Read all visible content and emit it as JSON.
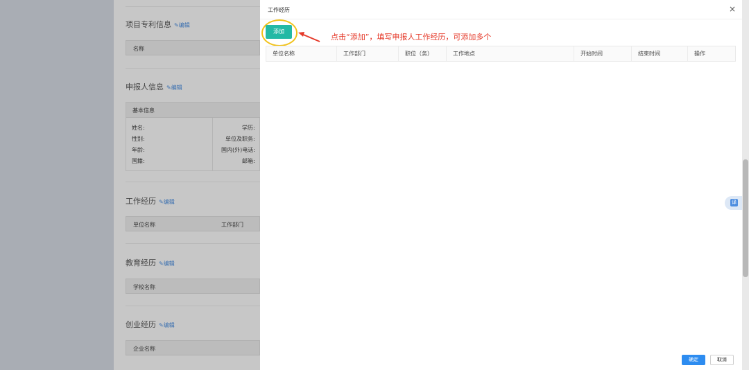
{
  "background_page": {
    "sections": [
      {
        "title": "项目专利信息",
        "edit": "编辑",
        "columns": [
          "名称"
        ]
      },
      {
        "title": "申报人信息",
        "edit": "编辑",
        "sub_header": "基本信息",
        "fields_left": [
          "姓名:",
          "性别:",
          "年龄:",
          "国籍:"
        ],
        "fields_right": [
          "学历:",
          "单位及职务:",
          "国内(外)电话:",
          "邮箱:"
        ]
      },
      {
        "title": "工作经历",
        "edit": "编辑",
        "columns": [
          "单位名称",
          "工作部门"
        ]
      },
      {
        "title": "教育经历",
        "edit": "编辑",
        "columns": [
          "学校名称"
        ]
      },
      {
        "title": "创业经历",
        "edit": "编辑",
        "columns": [
          "企业名称"
        ]
      }
    ]
  },
  "drawer": {
    "title": "工作经历",
    "close": "×",
    "add_button": "添加",
    "annotation": "点击“添加”，填写申报人工作经历，可添加多个",
    "table_columns": [
      "单位名称",
      "工作部门",
      "职位（务）",
      "工作地点",
      "开始时间",
      "结束时间",
      "操作"
    ],
    "confirm_button": "确定",
    "cancel_button": "取消"
  },
  "translate_widget": "译",
  "colors": {
    "add_button": "#23b9a5",
    "confirm_button": "#2d8cf0",
    "annotation": "#e53a2a",
    "highlight": "#f1c21b"
  }
}
